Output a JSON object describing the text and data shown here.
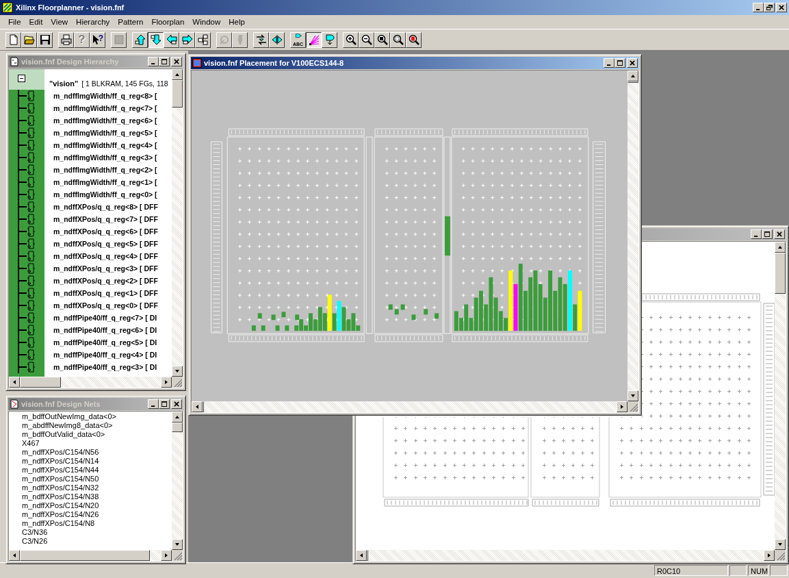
{
  "app": {
    "title": "Xilinx Floorplanner - vision.fnf"
  },
  "menu": [
    "File",
    "Edit",
    "View",
    "Hierarchy",
    "Pattern",
    "Floorplan",
    "Window",
    "Help"
  ],
  "toolbar": [
    [
      {
        "kind": "new",
        "pressed": false,
        "disabled": false
      },
      {
        "kind": "open",
        "pressed": false,
        "disabled": false
      },
      {
        "kind": "save",
        "pressed": false,
        "disabled": false
      }
    ],
    [
      {
        "kind": "print",
        "pressed": false,
        "disabled": false
      },
      {
        "kind": "help",
        "glyph": "?",
        "pressed": false,
        "disabled": true
      },
      {
        "kind": "context-help",
        "glyph": "?",
        "pressed": false,
        "disabled": false
      }
    ],
    [
      {
        "kind": "stop",
        "pressed": false,
        "disabled": true
      }
    ],
    [
      {
        "kind": "hier-up",
        "pressed": false,
        "disabled": false
      },
      {
        "kind": "hier-down",
        "pressed": true,
        "disabled": false
      },
      {
        "kind": "move-left",
        "pressed": false,
        "disabled": false
      },
      {
        "kind": "move-right",
        "pressed": false,
        "disabled": false
      },
      {
        "kind": "hier-tree",
        "pressed": false,
        "disabled": false
      }
    ],
    [
      {
        "kind": "edit-logic",
        "pressed": false,
        "disabled": true
      },
      {
        "kind": "probe",
        "pressed": false,
        "disabled": true
      }
    ],
    [
      {
        "kind": "swap",
        "pressed": false,
        "disabled": false
      },
      {
        "kind": "mirror",
        "pressed": false,
        "disabled": false
      }
    ],
    [
      {
        "kind": "label",
        "glyph": "ABC",
        "pressed": false,
        "disabled": false
      },
      {
        "kind": "ratsnest",
        "pressed": true,
        "disabled": false
      },
      {
        "kind": "flow",
        "pressed": false,
        "disabled": false
      }
    ],
    [
      {
        "kind": "zoom-in",
        "pressed": false,
        "disabled": false
      },
      {
        "kind": "zoom-out",
        "pressed": false,
        "disabled": false
      },
      {
        "kind": "zoom-full",
        "pressed": false,
        "disabled": false
      },
      {
        "kind": "zoom-area",
        "pressed": false,
        "disabled": false
      },
      {
        "kind": "zoom-select",
        "pressed": false,
        "disabled": false
      }
    ]
  ],
  "hierarchy_window": {
    "title": "vision.fnf Design Hierarchy",
    "active": false,
    "root": {
      "name": "\"vision\"",
      "summary": "[ 1 BLKRAM, 145 FGs, 118",
      "expanded": true,
      "children": [
        {
          "label": "m_ndffImgWidth/ff_q_reg<8> ["
        },
        {
          "label": "m_ndffImgWidth/ff_q_reg<7> ["
        },
        {
          "label": "m_ndffImgWidth/ff_q_reg<6> ["
        },
        {
          "label": "m_ndffImgWidth/ff_q_reg<5> ["
        },
        {
          "label": "m_ndffImgWidth/ff_q_reg<4> ["
        },
        {
          "label": "m_ndffImgWidth/ff_q_reg<3> ["
        },
        {
          "label": "m_ndffImgWidth/ff_q_reg<2> ["
        },
        {
          "label": "m_ndffImgWidth/ff_q_reg<1> ["
        },
        {
          "label": "m_ndffImgWidth/ff_q_reg<0> ["
        },
        {
          "label": "m_ndffXPos/q_q_reg<8> [ DFF"
        },
        {
          "label": "m_ndffXPos/q_q_reg<7> [ DFF"
        },
        {
          "label": "m_ndffXPos/q_q_reg<6> [ DFF"
        },
        {
          "label": "m_ndffXPos/q_q_reg<5> [ DFF"
        },
        {
          "label": "m_ndffXPos/q_q_reg<4> [ DFF"
        },
        {
          "label": "m_ndffXPos/q_q_reg<3> [ DFF"
        },
        {
          "label": "m_ndffXPos/q_q_reg<2> [ DFF"
        },
        {
          "label": "m_ndffXPos/q_q_reg<1> [ DFF"
        },
        {
          "label": "m_ndffXPos/q_q_reg<0> [ DFF"
        },
        {
          "label": "m_ndffPipe40/ff_q_reg<7> [ DI"
        },
        {
          "label": "m_ndffPipe40/ff_q_reg<6> [ DI"
        },
        {
          "label": "m_ndffPipe40/ff_q_reg<5> [ DI"
        },
        {
          "label": "m_ndffPipe40/ff_q_reg<4> [ DI"
        },
        {
          "label": "m_ndffPipe40/ff_q_reg<3> [ DI"
        }
      ]
    }
  },
  "nets_window": {
    "title": "vision.fnf Design Nets",
    "active": false,
    "nets": [
      "m_bdffOutNewImg_data<0>",
      "m_abdffNewImg8_data<0>",
      "m_bdffOutValid_data<0>",
      "X467",
      "m_ndffXPos/C154/N56",
      "m_ndffXPos/C154/N14",
      "m_ndffXPos/C154/N44",
      "m_ndffXPos/C154/N50",
      "m_ndffXPos/C154/N32",
      "m_ndffXPos/C154/N38",
      "m_ndffXPos/C154/N20",
      "m_ndffXPos/C154/N26",
      "m_ndffXPos/C154/N8",
      "C3/N36",
      "C3/N26"
    ]
  },
  "placement_window": {
    "title": "vision.fnf Placement for V100ECS144-8",
    "active": true
  },
  "background_window": {
    "active": false
  },
  "status_bar": {
    "position": "R0C10",
    "num_lock": "NUM"
  }
}
